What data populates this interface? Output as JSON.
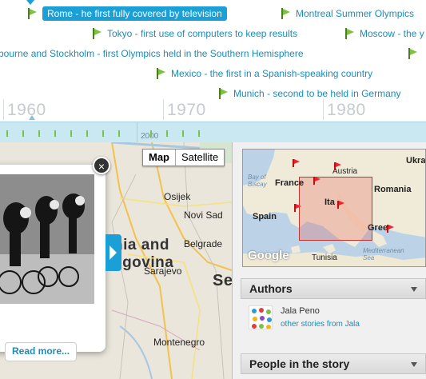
{
  "timeline": {
    "events": [
      {
        "label": "Rome - he first fully covered by television",
        "selected": true
      },
      {
        "label": "Montreal Summer Olympics",
        "selected": false
      },
      {
        "label": "Tokyo - first use of computers to keep results",
        "selected": false
      },
      {
        "label": "Moscow - the y",
        "selected": false
      },
      {
        "label": "bourne and Stockholm - first Olympics held in the Southern Hemisphere",
        "selected": false
      },
      {
        "label": "Mexico - the first in a Spanish-speaking country",
        "selected": false
      },
      {
        "label": "Munich - second to be held in Germany",
        "selected": false
      }
    ],
    "decades": [
      "1960",
      "1970",
      "1980"
    ],
    "overview_label": "2000"
  },
  "map": {
    "type_buttons": [
      "Map",
      "Satellite"
    ],
    "active_type": "Map",
    "labels": {
      "osijek": "Osijek",
      "novi_sad": "Novi Sad",
      "belgrade": "Belgrade",
      "sarajevo": "Sarajevo",
      "montenegro": "Montenegro",
      "region_line1": "nia and",
      "region_line2": "egovina",
      "serbia_partial": "Se"
    },
    "popup": {
      "close": "×",
      "read_more": "Read more..."
    }
  },
  "minimap": {
    "labels": {
      "france": "France",
      "spain": "Spain",
      "italy": "Ita",
      "austria": "Austria",
      "romania": "Romania",
      "ukraine": "Ukra",
      "greece": "Gree",
      "tunisia": "Tunisia",
      "bay_of_biscay": "Bay of Biscay",
      "mediterranean": "Mediterranean Sea"
    },
    "logo": "Google"
  },
  "sidebar": {
    "authors": {
      "title": "Authors",
      "name": "Jala Peno",
      "link": "other stories from Jala"
    },
    "people": {
      "title": "People in the story"
    }
  },
  "colors": {
    "accent": "#1a9fd6",
    "flag": "#7cc242",
    "link": "#1a8db8"
  }
}
